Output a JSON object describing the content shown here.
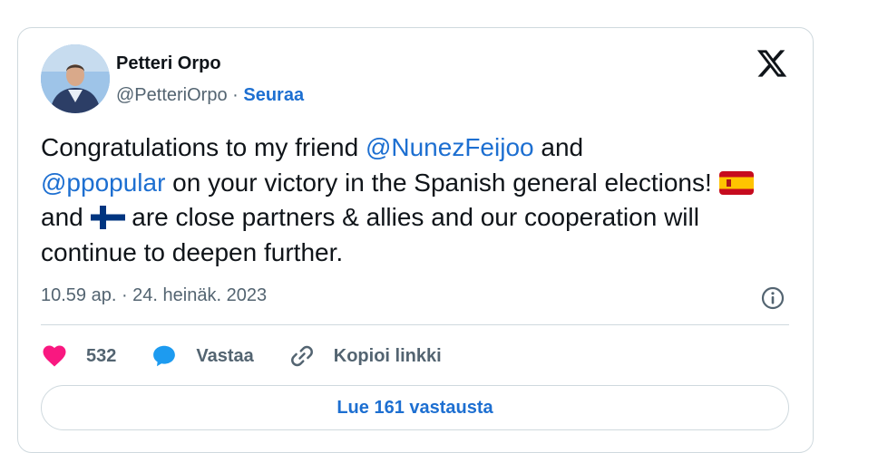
{
  "author": {
    "name": "Petteri Orpo",
    "handle": "@PetteriOrpo",
    "separator": "·",
    "follow_label": "Seuraa"
  },
  "tweet": {
    "part1": "Congratulations to my friend ",
    "mention1": "@NunezFeijoo",
    "part2": " and ",
    "mention2": "@ppopular",
    "part3": " on your victory in the Spanish general elections! ",
    "part4": " and ",
    "part5": " are close partners & allies and our cooperation will continue to deepen further."
  },
  "timestamp": "10.59 ap. · 24. heinäk. 2023",
  "actions": {
    "like_count": "532",
    "reply_label": "Vastaa",
    "copy_link_label": "Kopioi linkki"
  },
  "read_replies_label": "Lue 161 vastausta",
  "icons": {
    "brand": "x-logo-icon",
    "info": "info-icon",
    "like": "heart-icon",
    "reply": "speech-bubble-icon",
    "copy": "link-icon",
    "flag_1": "spain-flag-icon",
    "flag_2": "finland-flag-icon"
  },
  "colors": {
    "accent": "#1d6fd1",
    "heart": "#f91880",
    "reply_bubble": "#1d9bf0",
    "muted_text": "#536471",
    "border": "#cfd9de"
  }
}
